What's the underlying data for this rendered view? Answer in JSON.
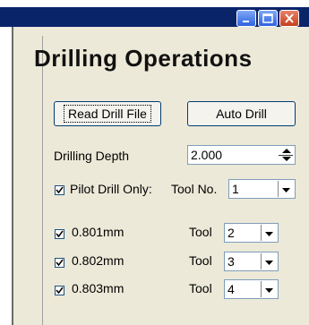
{
  "window": {
    "title": "Drilling Operations",
    "controls": [
      "minimize-icon",
      "maximize-icon",
      "close-icon"
    ]
  },
  "buttons": {
    "read_drill_file": "Read Drill File",
    "auto_drill": "Auto Drill"
  },
  "drilling_depth": {
    "label": "Drilling Depth",
    "value": "2.000"
  },
  "pilot_drill": {
    "label": "Pilot Drill Only:",
    "checked": true,
    "tool_label": "Tool No.",
    "tool_value": "1"
  },
  "drills": [
    {
      "size": "0.801mm",
      "checked": true,
      "tool_label": "Tool",
      "tool_value": "2"
    },
    {
      "size": "0.802mm",
      "checked": true,
      "tool_label": "Tool",
      "tool_value": "3"
    },
    {
      "size": "0.803mm",
      "checked": true,
      "tool_label": "Tool",
      "tool_value": "4"
    }
  ],
  "colors": {
    "titlebar": "#0a246a",
    "panel": "#ece9d8",
    "button_border": "#003c74",
    "field_border": "#7f9db9"
  }
}
